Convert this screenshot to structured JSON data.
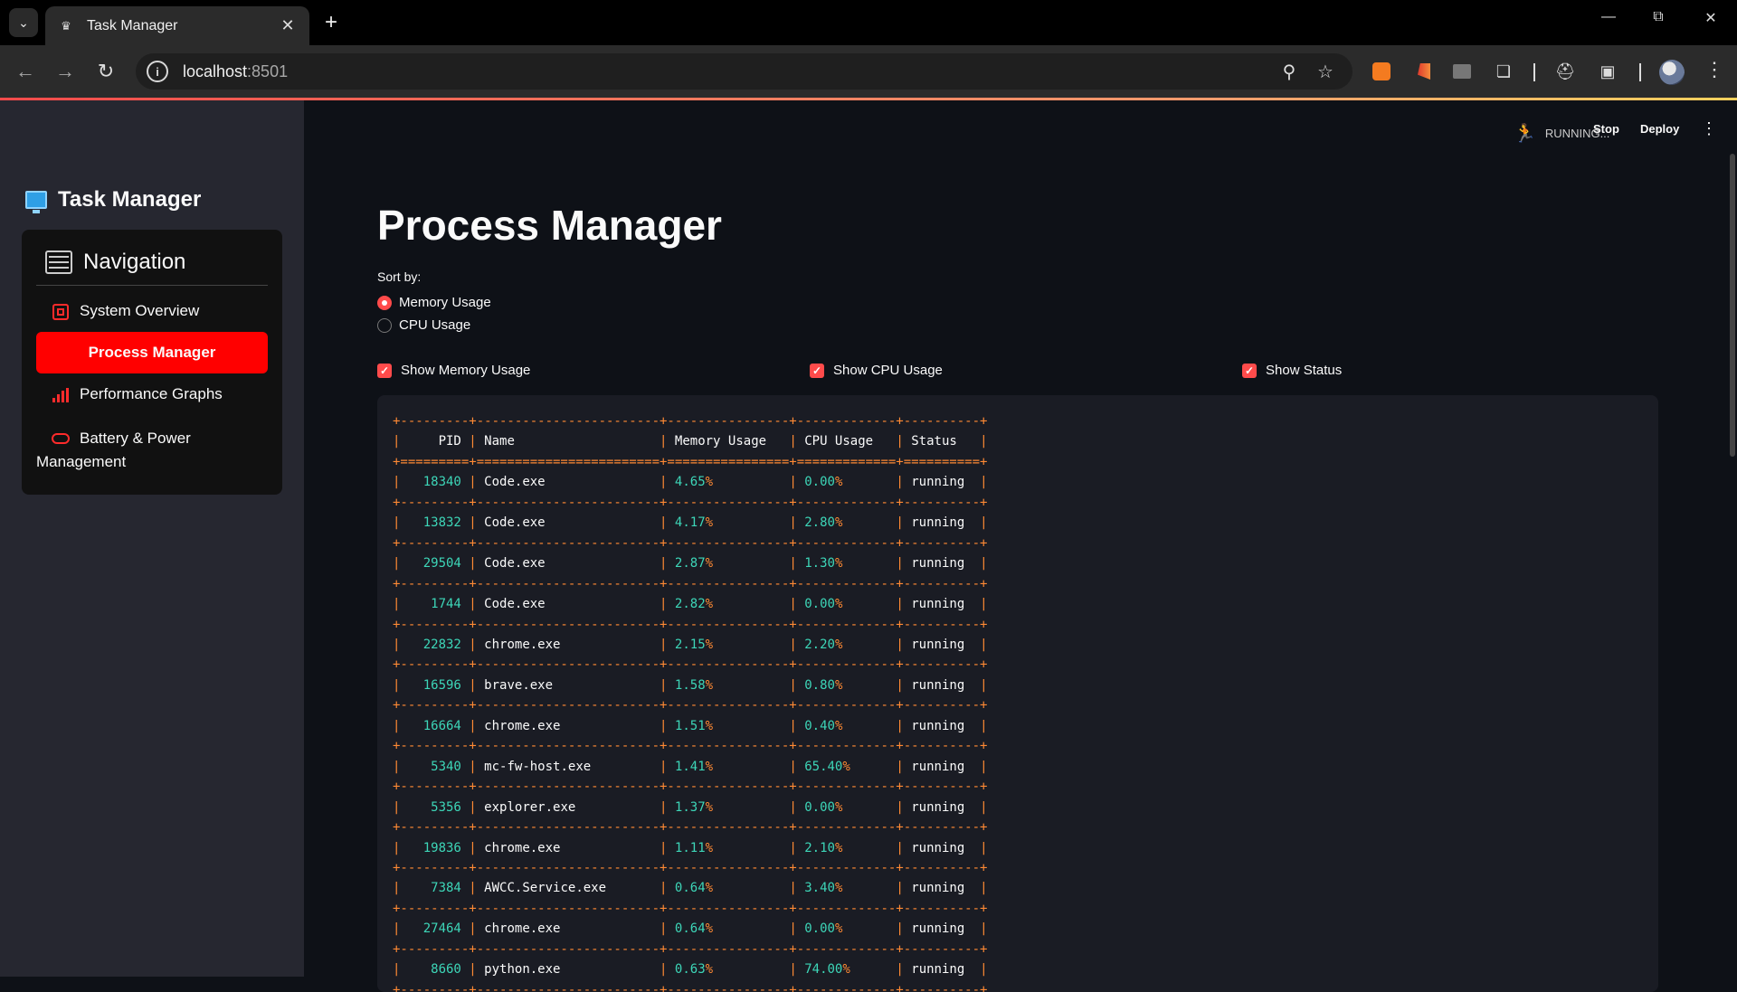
{
  "browser": {
    "tab_title": "Task Manager",
    "url_host": "localhost",
    "url_port": ":8501"
  },
  "app": {
    "sidebar_title": "Task Manager",
    "nav_header": "Navigation",
    "nav_items": [
      {
        "label": "System Overview",
        "icon": "chip-icon"
      },
      {
        "label": "Process Manager",
        "icon": "none",
        "active": true
      },
      {
        "label": "Performance Graphs",
        "icon": "bar-chart-icon"
      },
      {
        "label": "Battery & Power Management",
        "icon": "battery-icon"
      }
    ],
    "status": {
      "running": "RUNNING...",
      "stop": "Stop",
      "deploy": "Deploy"
    }
  },
  "main": {
    "title": "Process Manager",
    "sort_label": "Sort by:",
    "sort_options": [
      {
        "label": "Memory Usage",
        "selected": true
      },
      {
        "label": "CPU Usage",
        "selected": false
      }
    ],
    "checkboxes": [
      {
        "label": "Show Memory Usage",
        "checked": true
      },
      {
        "label": "Show CPU Usage",
        "checked": true
      },
      {
        "label": "Show Status",
        "checked": true
      }
    ]
  },
  "process_table": {
    "headers": [
      "PID",
      "Name",
      "Memory Usage",
      "CPU Usage",
      "Status"
    ],
    "rows": [
      {
        "pid": "18340",
        "name": "Code.exe",
        "mem": "4.65%",
        "cpu": "0.00%",
        "status": "running"
      },
      {
        "pid": "13832",
        "name": "Code.exe",
        "mem": "4.17%",
        "cpu": "2.80%",
        "status": "running"
      },
      {
        "pid": "29504",
        "name": "Code.exe",
        "mem": "2.87%",
        "cpu": "1.30%",
        "status": "running"
      },
      {
        "pid": "1744",
        "name": "Code.exe",
        "mem": "2.82%",
        "cpu": "0.00%",
        "status": "running"
      },
      {
        "pid": "22832",
        "name": "chrome.exe",
        "mem": "2.15%",
        "cpu": "2.20%",
        "status": "running"
      },
      {
        "pid": "16596",
        "name": "brave.exe",
        "mem": "1.58%",
        "cpu": "0.80%",
        "status": "running"
      },
      {
        "pid": "16664",
        "name": "chrome.exe",
        "mem": "1.51%",
        "cpu": "0.40%",
        "status": "running"
      },
      {
        "pid": "5340",
        "name": "mc-fw-host.exe",
        "mem": "1.41%",
        "cpu": "65.40%",
        "status": "running"
      },
      {
        "pid": "5356",
        "name": "explorer.exe",
        "mem": "1.37%",
        "cpu": "0.00%",
        "status": "running"
      },
      {
        "pid": "19836",
        "name": "chrome.exe",
        "mem": "1.11%",
        "cpu": "2.10%",
        "status": "running"
      },
      {
        "pid": "7384",
        "name": "AWCC.Service.exe",
        "mem": "0.64%",
        "cpu": "3.40%",
        "status": "running"
      },
      {
        "pid": "27464",
        "name": "chrome.exe",
        "mem": "0.64%",
        "cpu": "0.00%",
        "status": "running"
      },
      {
        "pid": "8660",
        "name": "python.exe",
        "mem": "0.63%",
        "cpu": "74.00%",
        "status": "running"
      }
    ]
  }
}
